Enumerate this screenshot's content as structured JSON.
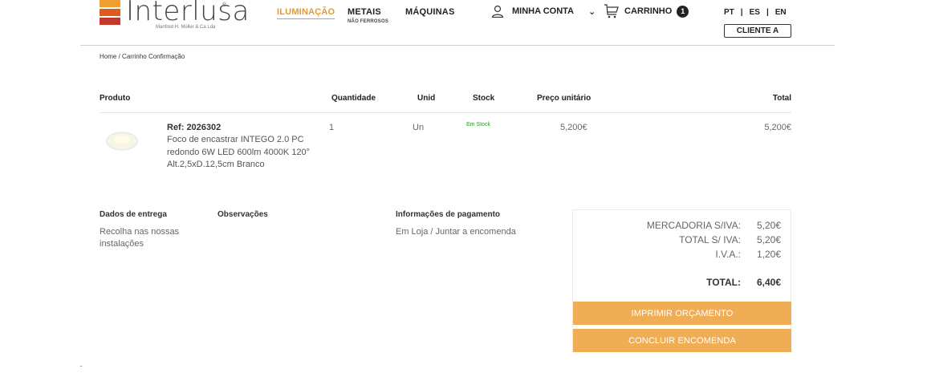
{
  "brand": {
    "name": "Interlusa",
    "registered": "®",
    "tagline": "Manfred H. Müller & Ca Lda",
    "colors": [
      "#f0a030",
      "#e05a1e",
      "#c0392b"
    ]
  },
  "nav": {
    "items": [
      {
        "label": "ILUMINAÇÃO",
        "active": true
      },
      {
        "label": "METAIS",
        "sub": "NÃO FERROSOS"
      },
      {
        "label": "MÁQUINAS"
      }
    ],
    "account_label": "MINHA CONTA",
    "cart_label": "CARRINHO",
    "cart_count": "1",
    "languages": [
      "PT",
      "ES",
      "EN"
    ],
    "client_button": "CLIENTE A"
  },
  "breadcrumb": {
    "home": "Home",
    "separator": "/",
    "current": "Carrinho Confirmação"
  },
  "table": {
    "headers": {
      "product": "Produto",
      "quantity": "Quantidade",
      "unit": "Unid",
      "stock": "Stock",
      "unit_price": "Preço unitário",
      "total": "Total"
    },
    "rows": [
      {
        "ref": "Ref: 2026302",
        "description": "Foco de encastrar INTEGO 2.0 PC redondo 6W LED 600lm 4000K 120° Alt.2,5xD.12,5cm Branco",
        "quantity": "1",
        "unit": "Un",
        "stock": "Em Stock",
        "unit_price": "5,200€",
        "total": "5,200€"
      }
    ]
  },
  "delivery": {
    "title": "Dados de entrega",
    "value": "Recolha nas nossas instalações"
  },
  "observations": {
    "title": "Observações",
    "value": ""
  },
  "payment": {
    "title": "Informações de pagamento",
    "value": "Em Loja / Juntar a encomenda"
  },
  "summary": {
    "rows": [
      {
        "label": "MERCADORIA S/IVA:",
        "value": "5,20€"
      },
      {
        "label": "TOTAL S/ IVA:",
        "value": "5,20€"
      },
      {
        "label": "I.V.A.:",
        "value": "1,20€"
      }
    ],
    "total_label": "TOTAL:",
    "total_value": "6,40€",
    "print_button": "IMPRIMIR ORÇAMENTO",
    "checkout_button": "CONCLUIR ENCOMENDA",
    "accent": "#efae55"
  }
}
